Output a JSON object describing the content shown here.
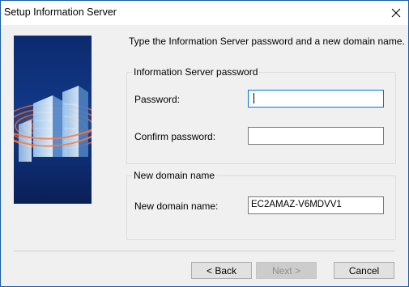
{
  "window": {
    "title": "Setup Information Server"
  },
  "intro": "Type the Information Server password and a new domain name.",
  "password_group": {
    "title": "Information Server password",
    "password_label": "Password:",
    "password_value": "",
    "confirm_label": "Confirm password:",
    "confirm_value": ""
  },
  "domain_group": {
    "title": "New domain name",
    "domain_label": "New domain name:",
    "domain_value": "EC2AMAZ-V6MDVV1"
  },
  "buttons": {
    "back": "< Back",
    "next": "Next >",
    "cancel": "Cancel"
  },
  "colors": {
    "accent": "#0078d7",
    "banner_dark": "#0a1f57",
    "banner_glow": "#e8642c"
  }
}
